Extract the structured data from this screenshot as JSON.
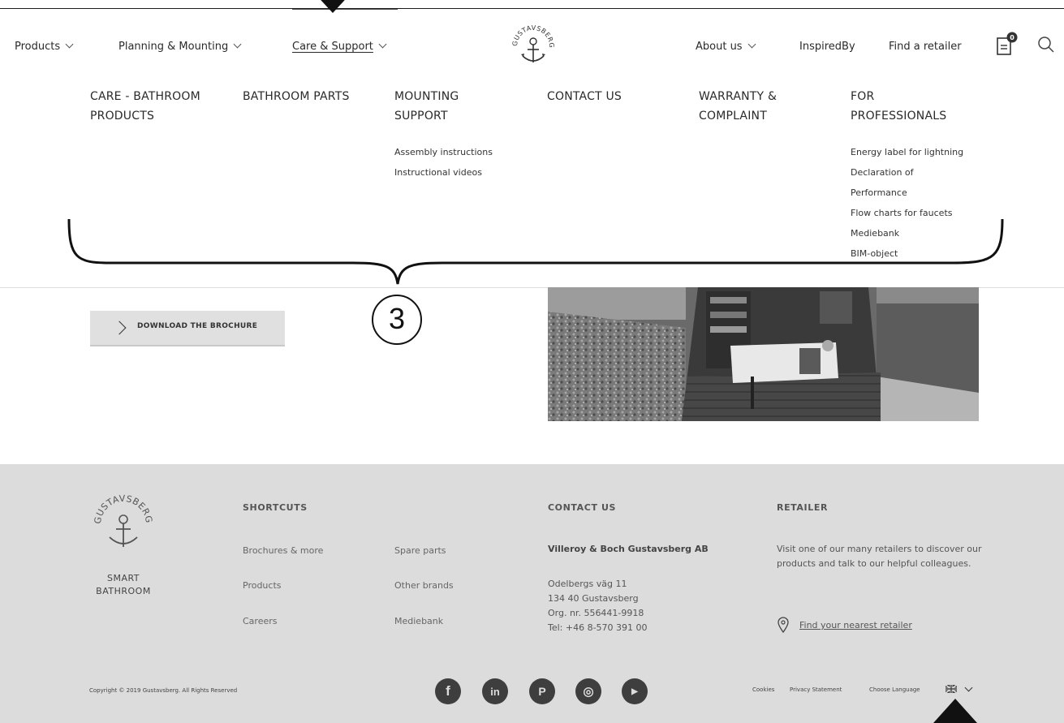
{
  "nav": {
    "items": [
      {
        "label": "Products"
      },
      {
        "label": "Planning & Mounting"
      },
      {
        "label": "Care & Support"
      },
      {
        "label": "About us"
      },
      {
        "label": "InspiredBy"
      },
      {
        "label": "Find a retailer"
      }
    ],
    "brand": "GUSTAVSBERG",
    "cart_count": "0"
  },
  "mega_menu": {
    "columns": [
      {
        "heading": "CARE - BATHROOM\nPRODUCTS",
        "links": []
      },
      {
        "heading": "BATHROOM PARTS",
        "links": []
      },
      {
        "heading": "MOUNTING\nSUPPORT",
        "links": [
          "Assembly instructions",
          "Instructional videos"
        ]
      },
      {
        "heading": "CONTACT US",
        "links": []
      },
      {
        "heading": "WARRANTY &\nCOMPLAINT",
        "links": []
      },
      {
        "heading": "FOR\nPROFESSIONALS",
        "links": [
          "Energy label for lightning",
          "Declaration of",
          "Performance",
          "Flow charts for faucets",
          "Mediebank",
          "BIM-object"
        ]
      }
    ]
  },
  "annotation": {
    "number": "3"
  },
  "content": {
    "download_label": "DOWNLOAD THE BROCHURE"
  },
  "footer": {
    "brand_line1": "SMART",
    "brand_line2": "BATHROOM",
    "shortcuts": {
      "heading": "SHORTCUTS",
      "links": [
        "Brochures & more",
        "Spare parts",
        "Products",
        "Other brands",
        "Careers",
        "Mediebank"
      ]
    },
    "contact": {
      "heading": "CONTACT US",
      "company": "Villeroy & Boch Gustavsberg AB",
      "lines": [
        "Odelbergs väg 11",
        "134 40 Gustavsberg",
        "Org. nr. 556441-9918",
        "Tel: +46 8-570 391 00"
      ]
    },
    "retailer": {
      "heading": "RETAILER",
      "text": "Visit one of our many retailers to discover our products and talk to our helpful colleagues.",
      "link": "Find your nearest retailer"
    },
    "copyright": "Copyright © 2019 Gustavsberg. All Rights Reserved",
    "social": [
      "f",
      "in",
      "P",
      "◎",
      "▶"
    ],
    "legal": [
      "Cookies",
      "Privacy Statement",
      "Choose Language"
    ]
  },
  "colors": {
    "footer_bg": "#dcdcdc",
    "button_bg": "#e0e0e0",
    "dark": "#3e3e3e"
  }
}
